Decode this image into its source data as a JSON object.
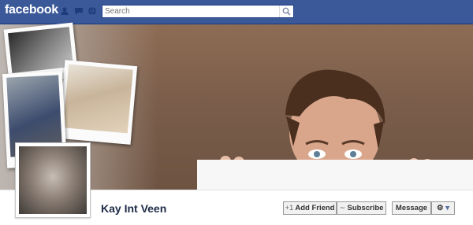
{
  "topbar": {
    "logo": "facebook",
    "search": {
      "placeholder": "Search",
      "value": ""
    }
  },
  "profile": {
    "name": "Kay Int Veen"
  },
  "actions": {
    "add_friend": "Add Friend",
    "subscribe": "Subscribe",
    "message": "Message"
  },
  "colors": {
    "brand_blue": "#3b5998",
    "cover_brown": "#7b5e4b",
    "name_text": "#1c2a47"
  },
  "icons": {
    "add_friend": "plus-icon",
    "subscribe": "rss-icon",
    "options": "gear-icon"
  }
}
